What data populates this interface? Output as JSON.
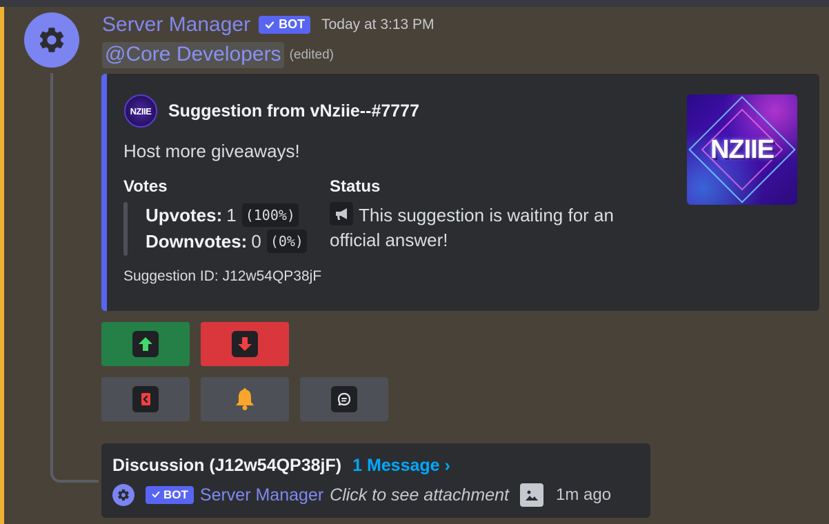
{
  "message": {
    "author": "Server Manager",
    "bot_tag": "BOT",
    "timestamp": "Today at 3:13 PM",
    "role_mention": "@Core Developers",
    "edited": "(edited)"
  },
  "embed": {
    "author_icon_text": "NZIIE",
    "author_name": "Suggestion from vNziie--#7777",
    "description": "Host more giveaways!",
    "votes": {
      "name": "Votes",
      "upvotes_label": "Upvotes:",
      "upvotes_value": "1",
      "upvotes_percent": "(100%)",
      "downvotes_label": "Downvotes:",
      "downvotes_value": "0",
      "downvotes_percent": "(0%)"
    },
    "status": {
      "name": "Status",
      "text": "This suggestion is waiting for an official answer!"
    },
    "footer": "Suggestion ID: J12w54QP38jF",
    "thumbnail_text": "NZIIE"
  },
  "buttons": [
    {
      "icon": "arrow-up-icon",
      "color": "#248046"
    },
    {
      "icon": "arrow-down-icon",
      "color": "#da373c"
    },
    {
      "icon": "exit-icon",
      "color": "#4e5058"
    },
    {
      "icon": "bell-icon",
      "color": "#4e5058"
    },
    {
      "icon": "speech-bubble-icon",
      "color": "#4e5058"
    }
  ],
  "thread": {
    "name": "Discussion (J12w54QP38jF)",
    "message_count": "1 Message ›",
    "bot_tag": "BOT",
    "preview_author": "Server Manager",
    "preview_text": "Click to see attachment",
    "time": "1m ago"
  },
  "colors": {
    "background": "#494239",
    "accent": "#5865f2",
    "mention_bar": "#f0b232",
    "embed_bg": "#2b2d31",
    "link": "#00a8fc"
  }
}
